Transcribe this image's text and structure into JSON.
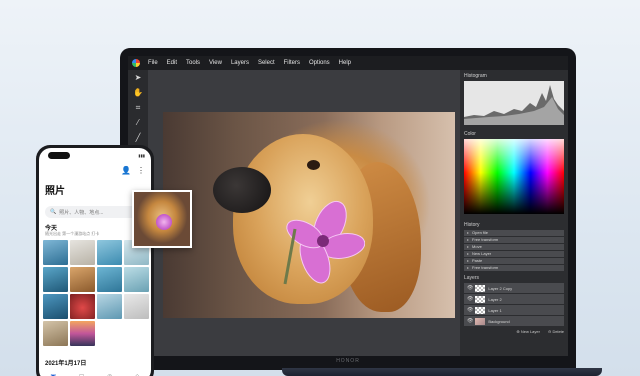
{
  "app": {
    "menu": [
      "File",
      "Edit",
      "Tools",
      "View",
      "Layers",
      "Select",
      "Filters",
      "Options",
      "Help"
    ],
    "tools": [
      "pointer-icon",
      "hand-icon",
      "crop-icon",
      "wand-icon",
      "line-icon"
    ],
    "panels": {
      "histogram_title": "Histogram",
      "color_title": "Color",
      "history_title": "History",
      "history_items": [
        "Open file",
        "Free transform",
        "Move",
        "New Layer",
        "Paste",
        "Free transform"
      ],
      "layers_title": "Layers",
      "layers": [
        "Layer 2 Copy",
        "Layer 2",
        "Layer 1",
        "Background"
      ],
      "new_layer": "New Layer",
      "delete": "Delete"
    },
    "brand": "HONOR"
  },
  "phone": {
    "title": "照片",
    "search_placeholder": "照片、人物、地点...",
    "today_label": "今天",
    "today_sub": "随光出走 第一个漫游站点 打卡",
    "date_label": "2021年1月17日"
  }
}
